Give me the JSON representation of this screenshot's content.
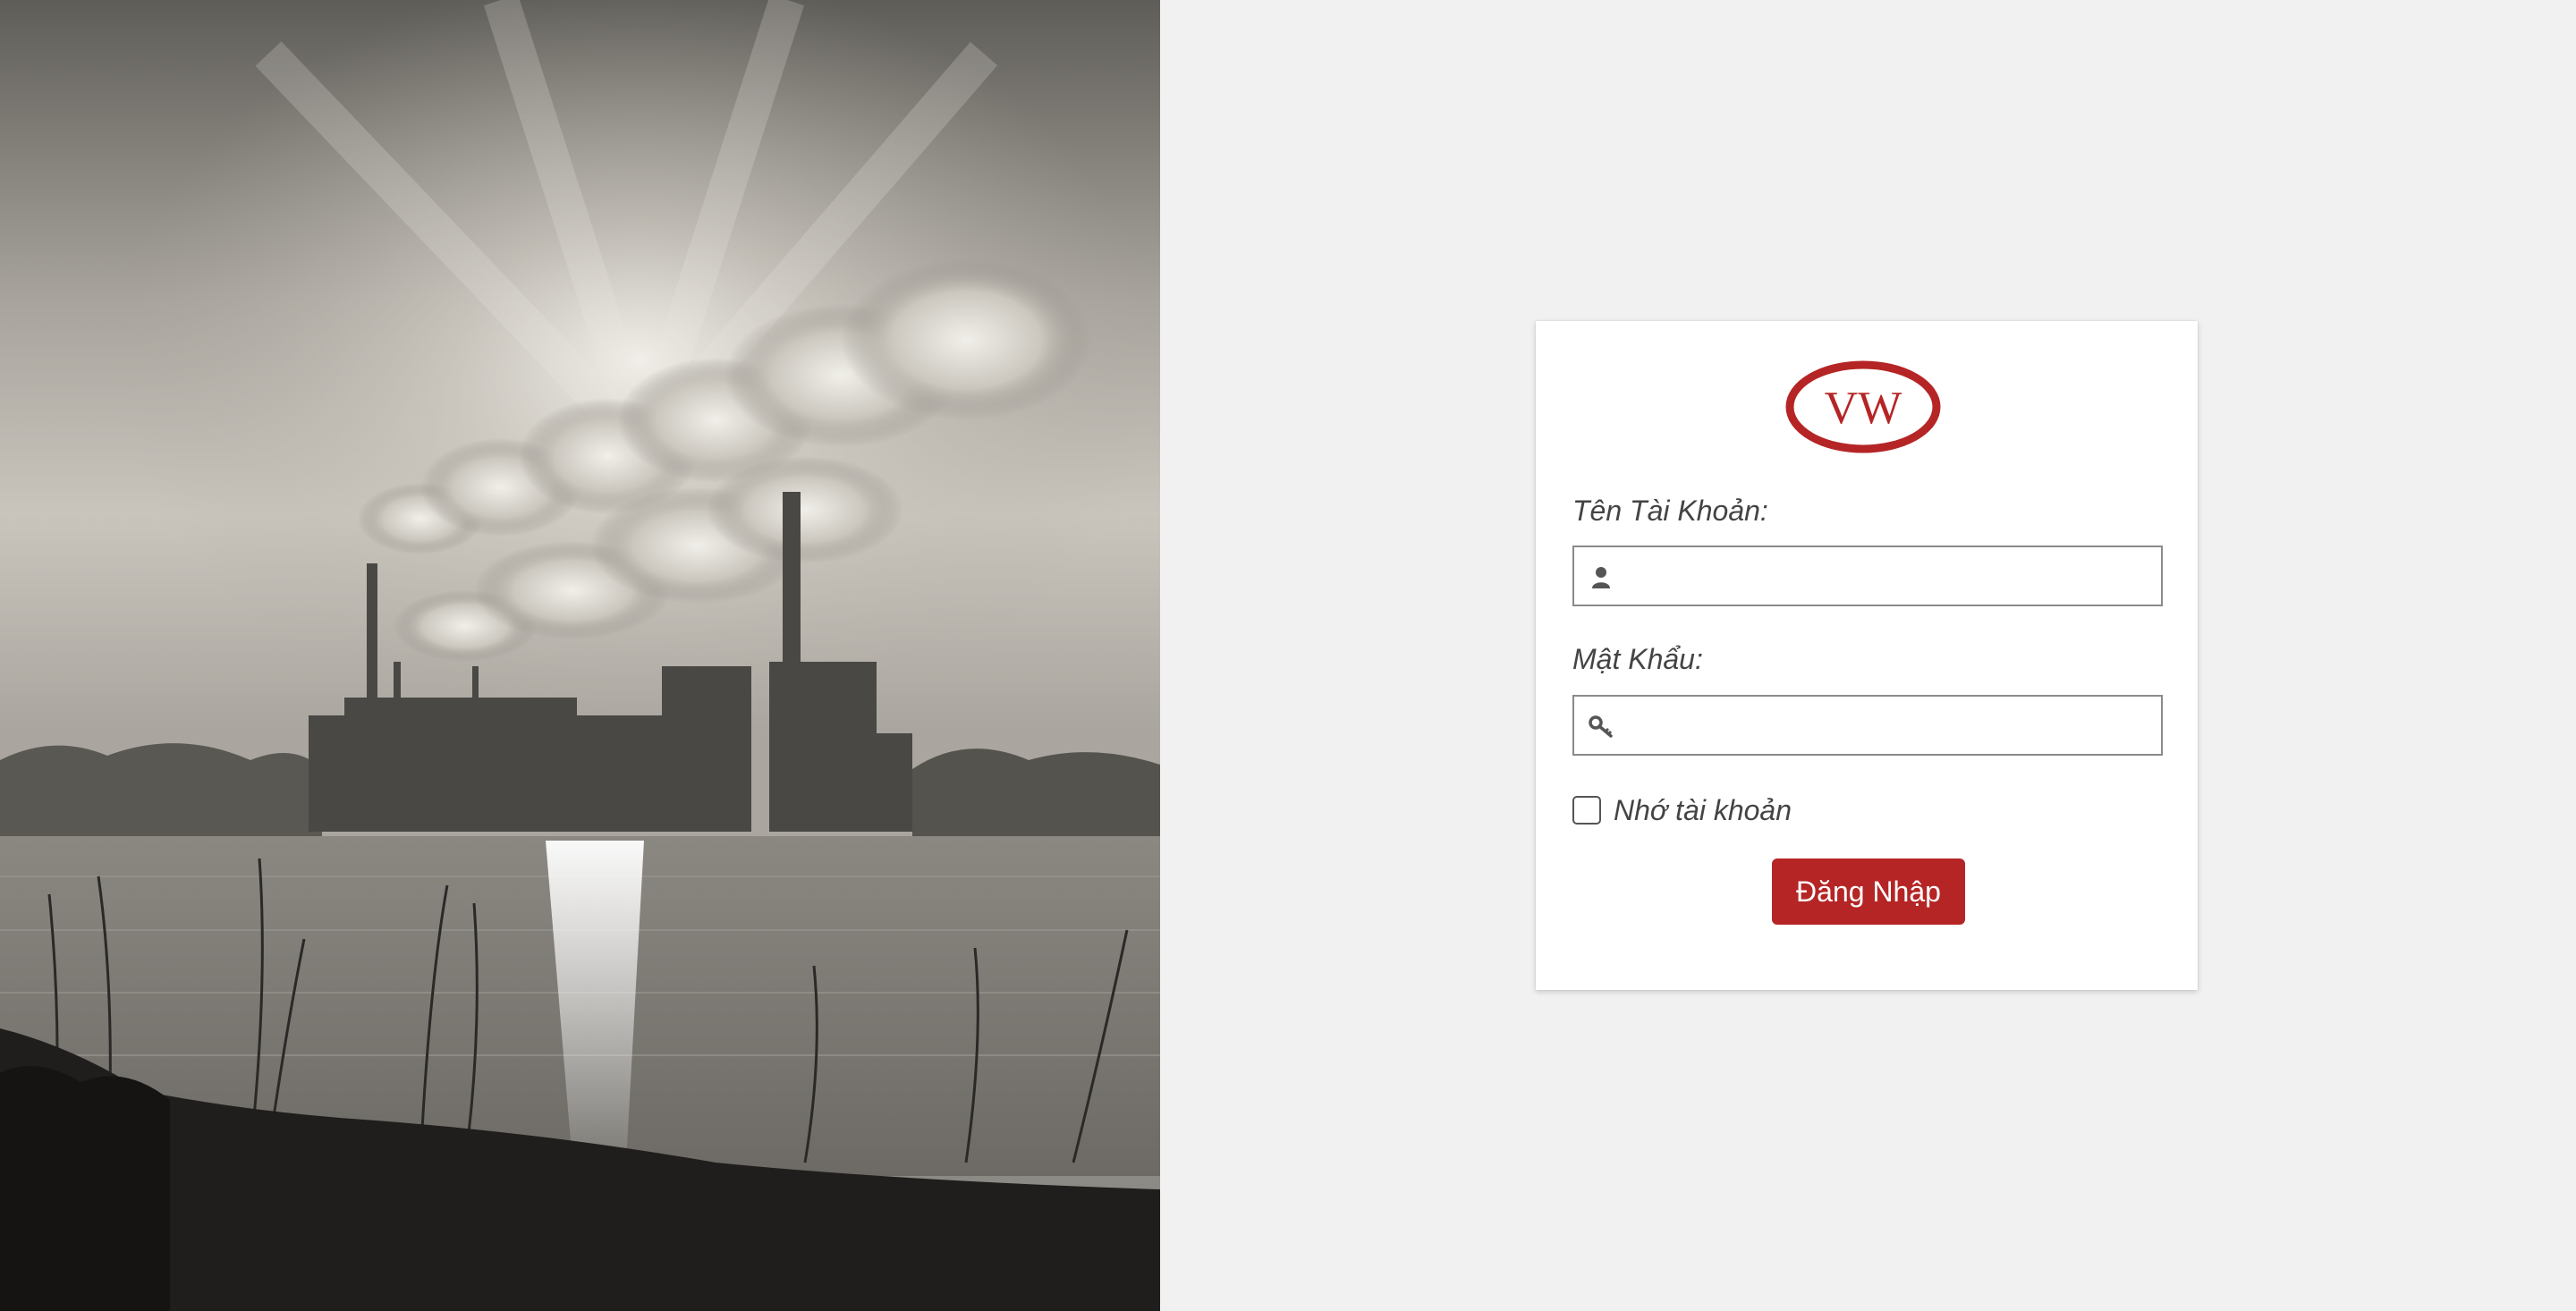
{
  "login": {
    "logo_letters": "VW",
    "username_label": "Tên Tài Khoản:",
    "username_value": "",
    "username_icon": "user-icon",
    "password_label": "Mật Khẩu:",
    "password_value": "",
    "password_icon": "key-icon",
    "remember_label": "Nhớ tài khoản",
    "remember_checked": false,
    "submit_label": "Đăng Nhập"
  },
  "colors": {
    "brand_red": "#b52525",
    "page_background": "#f1f1f1",
    "card_background": "#ffffff"
  }
}
